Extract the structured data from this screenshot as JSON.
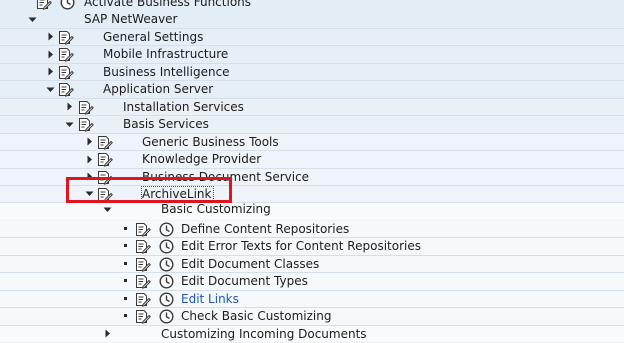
{
  "tree": {
    "rows": [
      {
        "label": "Activate Business Functions",
        "depth": 0,
        "arrow": "none",
        "icon": "doc-clock"
      },
      {
        "label": "SAP NetWeaver",
        "depth": 0,
        "arrow": "expanded",
        "icon": "none"
      },
      {
        "label": "General Settings",
        "depth": 1,
        "arrow": "collapsed",
        "icon": "doc-edit"
      },
      {
        "label": "Mobile Infrastructure",
        "depth": 1,
        "arrow": "collapsed",
        "icon": "doc-edit"
      },
      {
        "label": "Business Intelligence",
        "depth": 1,
        "arrow": "collapsed",
        "icon": "doc-edit"
      },
      {
        "label": "Application Server",
        "depth": 1,
        "arrow": "expanded",
        "icon": "doc-edit"
      },
      {
        "label": "Installation Services",
        "depth": 2,
        "arrow": "collapsed",
        "icon": "doc-edit"
      },
      {
        "label": "Basis Services",
        "depth": 2,
        "arrow": "expanded",
        "icon": "doc-edit"
      },
      {
        "label": "Generic Business Tools",
        "depth": 3,
        "arrow": "collapsed",
        "icon": "doc-edit"
      },
      {
        "label": "Knowledge Provider",
        "depth": 3,
        "arrow": "collapsed",
        "icon": "doc-edit"
      },
      {
        "label": "Business Document Service",
        "depth": 3,
        "arrow": "collapsed",
        "icon": "doc-edit"
      },
      {
        "label": "ArchiveLink",
        "depth": 3,
        "arrow": "expanded",
        "icon": "doc-edit",
        "focused": true
      },
      {
        "label": "Basic Customizing",
        "depth": 4,
        "arrow": "expanded",
        "icon": "none",
        "cut": true
      },
      {
        "label": "Define Content Repositories",
        "depth": 5,
        "arrow": "bullet",
        "icon": "doc-clock"
      },
      {
        "label": "Edit Error Texts for Content Repositories",
        "depth": 5,
        "arrow": "bullet",
        "icon": "doc-clock"
      },
      {
        "label": "Edit Document Classes",
        "depth": 5,
        "arrow": "bullet",
        "icon": "doc-clock"
      },
      {
        "label": "Edit Document Types",
        "depth": 5,
        "arrow": "bullet",
        "icon": "doc-clock"
      },
      {
        "label": "Edit Links",
        "depth": 5,
        "arrow": "bullet",
        "icon": "doc-clock",
        "link": true
      },
      {
        "label": "Check Basic Customizing",
        "depth": 5,
        "arrow": "bullet",
        "icon": "doc-clock"
      },
      {
        "label": "Customizing Incoming Documents",
        "depth": 4,
        "arrow": "collapsed",
        "icon": "none"
      }
    ]
  },
  "colors": {
    "link": "#1d56b5",
    "highlight_box": "#e0141e"
  }
}
